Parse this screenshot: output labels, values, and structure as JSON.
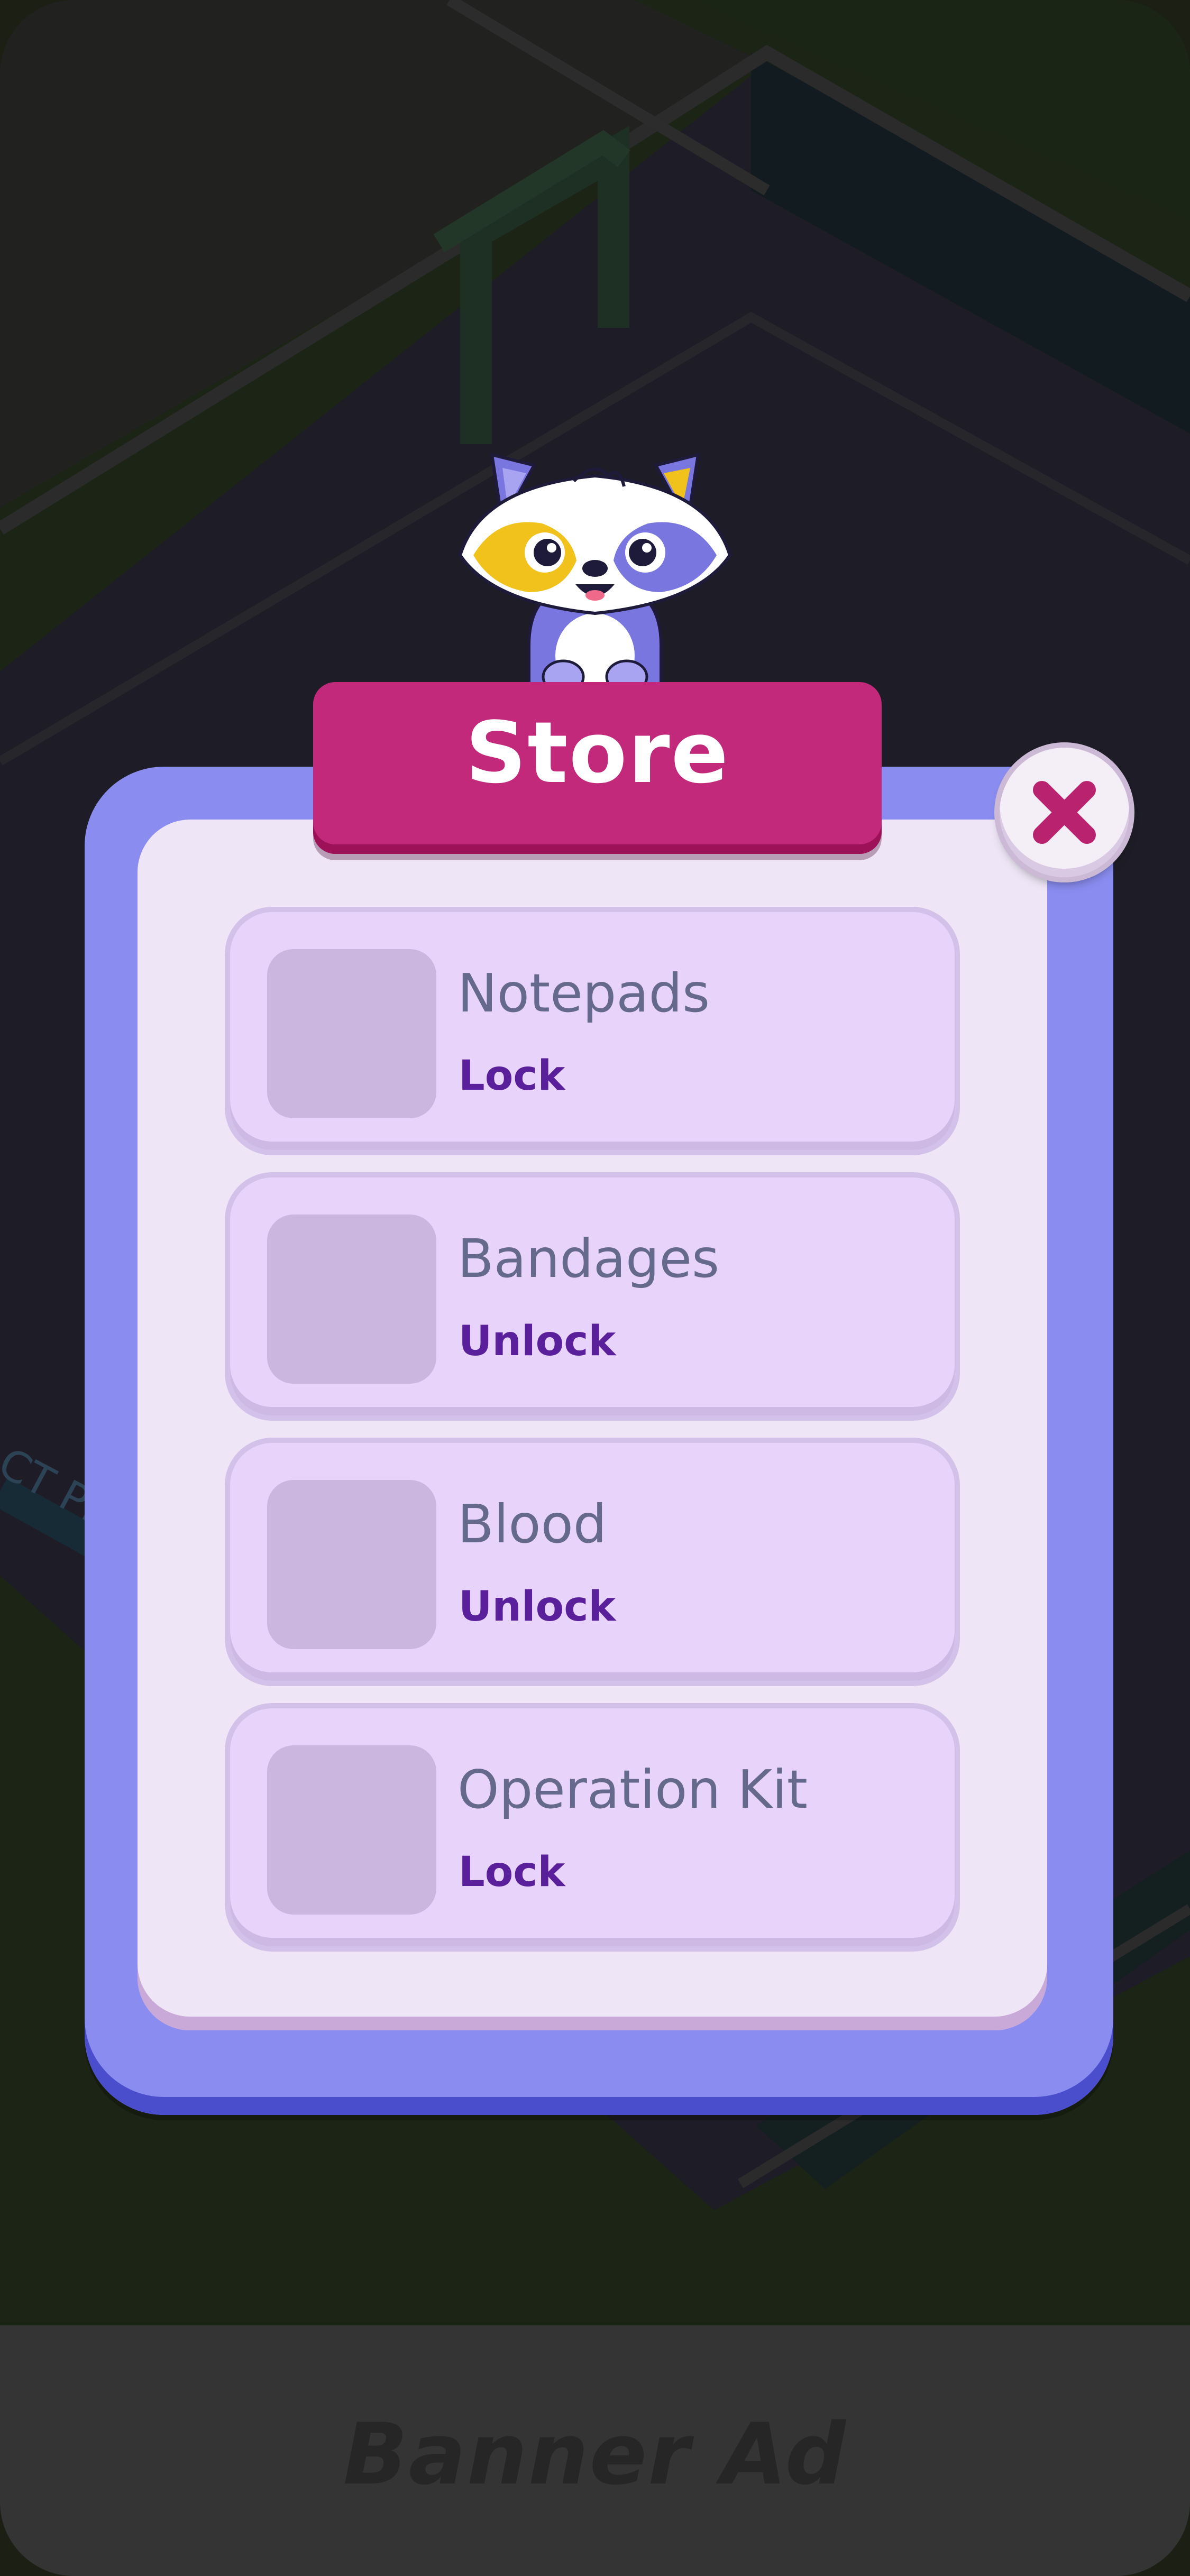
{
  "store": {
    "title": "Store",
    "items": [
      {
        "name": "Notepads",
        "status": "Lock"
      },
      {
        "name": "Bandages",
        "status": "Unlock"
      },
      {
        "name": "Blood",
        "status": "Unlock"
      },
      {
        "name": "Operation Kit",
        "status": "Lock"
      }
    ]
  },
  "banner": {
    "label": "Banner Ad"
  },
  "icons": {
    "close": "close-icon",
    "mascot": "raccoon-mascot"
  },
  "colors": {
    "title_plate": "#c3297a",
    "modal_frame": "#8a8cf0",
    "modal_panel": "#eee6f6",
    "item_card": "#e8d4fb",
    "status_text": "#5a1f9a",
    "close_x": "#b8226f"
  }
}
